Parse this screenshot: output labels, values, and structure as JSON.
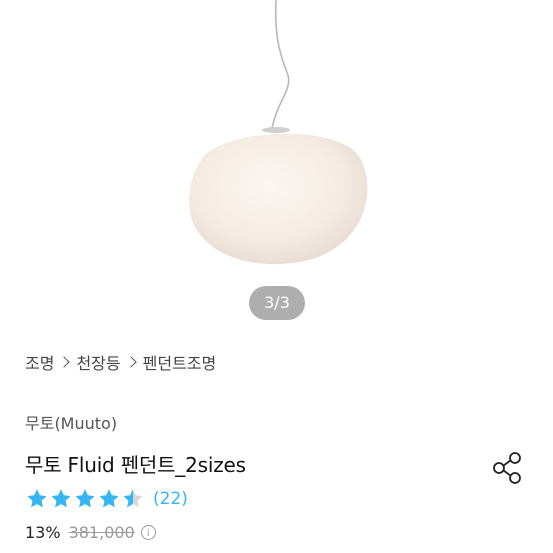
{
  "gallery": {
    "counter_text": "3/3",
    "image_name": "fluid-pendant-lamp-image"
  },
  "breadcrumb": {
    "items": [
      "조명",
      "천장등",
      "펜던트조명"
    ]
  },
  "product": {
    "brand": "무토(Muuto)",
    "title": "무토 Fluid 펜던트_2sizes",
    "rating_stars": 4.5,
    "review_count": "(22)",
    "discount": "13%",
    "original_price": "381,000"
  },
  "icons": {
    "share": "share-icon",
    "info": "info-icon",
    "star": "star-icon",
    "chevron": "chevron-right-icon"
  },
  "colors": {
    "star": "#35b6f0",
    "star_empty": "#d8d8d8",
    "review_count": "#35b6f0",
    "original_price": "#9a9a9a"
  }
}
